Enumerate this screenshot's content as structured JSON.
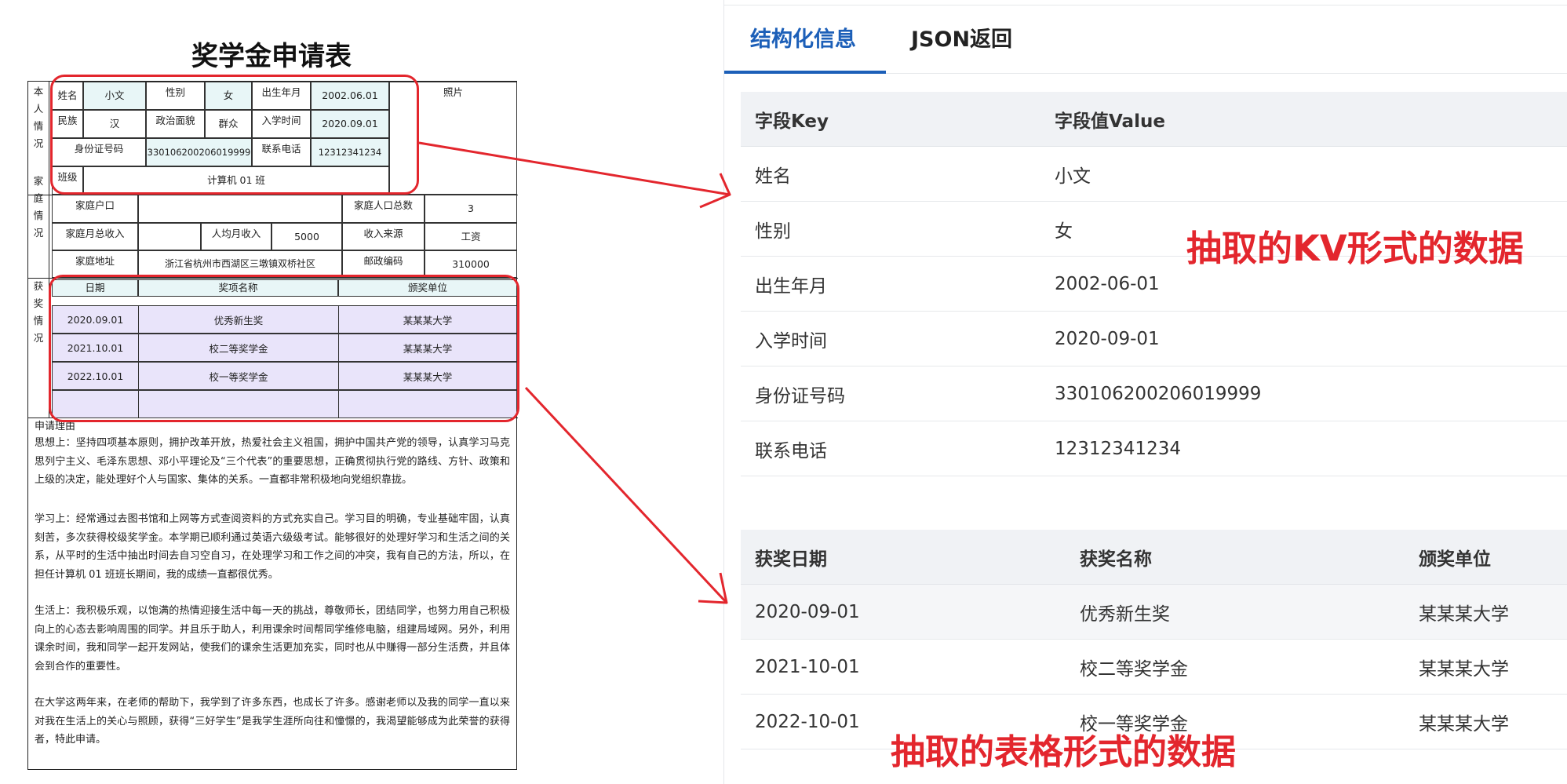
{
  "form": {
    "title": "奖学金申请表",
    "section_personal": "本\n人\n情\n况",
    "section_family": "家\n庭\n情\n况",
    "section_award": "获\n奖\n情\n况",
    "personal": {
      "name_label": "姓名",
      "name_value": "小文",
      "gender_label": "性别",
      "gender_value": "女",
      "birth_label": "出生年月",
      "birth_value": "2002.06.01",
      "photo_label": "照片",
      "ethnic_label": "民族",
      "ethnic_value": "汉",
      "political_label": "政治面貌",
      "political_value": "群众",
      "enroll_label": "入学时间",
      "enroll_value": "2020.09.01",
      "id_label": "身份证号码",
      "id_value": "330106200206019999",
      "phone_label": "联系电话",
      "phone_value": "12312341234",
      "class_label": "班级",
      "class_value": "计算机 01 班"
    },
    "family": {
      "hukou_label": "家庭户口",
      "hukou_value": "",
      "members_label": "家庭人口总数",
      "members_value": "3",
      "income_label": "家庭月总收入",
      "income_value": "",
      "avg_label": "人均月收入",
      "avg_value": "5000",
      "source_label": "收入来源",
      "source_value": "工资",
      "address_label": "家庭地址",
      "address_value": "浙江省杭州市西湖区三墩镇双桥社区",
      "zip_label": "邮政编码",
      "zip_value": "310000"
    },
    "awards": {
      "headers": [
        "日期",
        "奖项名称",
        "颁奖单位"
      ],
      "rows": [
        [
          "2020.09.01",
          "优秀新生奖",
          "某某某大学"
        ],
        [
          "2021.10.01",
          "校二等奖学金",
          "某某某大学"
        ],
        [
          "2022.10.01",
          "校一等奖学金",
          "某某某大学"
        ]
      ]
    },
    "reason_title": "申请理由",
    "paragraphs": [
      "思想上：坚持四项基本原则，拥护改革开放，热爱社会主义祖国，拥护中国共产党的领导，认真学习马克思列宁主义、毛泽东思想、邓小平理论及“三个代表”的重要思想，正确贯彻执行党的路线、方针、政策和上级的决定，能处理好个人与国家、集体的关系。一直都非常积极地向党组织靠拢。",
      "学习上：经常通过去图书馆和上网等方式查阅资料的方式充实自己。学习目的明确，专业基础牢固，认真刻苦，多次获得校级奖学金。本学期已顺利通过英语六级级考试。能够很好的处理好学习和生活之间的关系，从平时的生活中抽出时间去自习空自习，在处理学习和工作之间的冲突，我有自己的方法，所以，在担任计算机 01 班班长期间，我的成绩一直都很优秀。",
      "生活上：我积极乐观，以饱满的热情迎接生活中每一天的挑战，尊敬师长，团结同学，也努力用自己积极向上的心态去影响周围的同学。并且乐于助人，利用课余时间帮同学维修电脑，组建局域网。另外，利用课余时间，我和同学一起开发网站，使我们的课余生活更加充实，同时也从中赚得一部分生活费，并且体会到合作的重要性。",
      "在大学这两年来，在老师的帮助下，我学到了许多东西，也成长了许多。感谢老师以及我的同学一直以来对我在生活上的关心与照顾，获得“三好学生”是我学生涯所向往和憧憬的，我渴望能够成为此荣誉的获得者，特此申请。"
    ]
  },
  "panel": {
    "tabs": [
      {
        "label": "结构化信息",
        "active": true
      },
      {
        "label": "JSON返回",
        "active": false
      }
    ],
    "kv": {
      "headers": [
        "字段Key",
        "字段值Value"
      ],
      "rows": [
        [
          "姓名",
          "小文"
        ],
        [
          "性别",
          "女"
        ],
        [
          "出生年月",
          "2002-06-01"
        ],
        [
          "入学时间",
          "2020-09-01"
        ],
        [
          "身份证号码",
          "330106200206019999"
        ],
        [
          "联系电话",
          "12312341234"
        ]
      ]
    },
    "awards": {
      "headers": [
        "获奖日期",
        "获奖名称",
        "颁奖单位"
      ],
      "rows": [
        [
          "2020-09-01",
          "优秀新生奖",
          "某某某大学"
        ],
        [
          "2021-10-01",
          "校二等奖学金",
          "某某某大学"
        ],
        [
          "2022-10-01",
          "校一等奖学金",
          "某某某大学"
        ]
      ]
    }
  },
  "annotations": {
    "kv_label": "抽取的KV形式的数据",
    "table_label": "抽取的表格形式的数据",
    "color": "#e3262d"
  },
  "colors": {
    "accent": "#1c5fb8",
    "highlight_personal": "#e8f6f7",
    "highlight_award": "#e9e4fa"
  }
}
